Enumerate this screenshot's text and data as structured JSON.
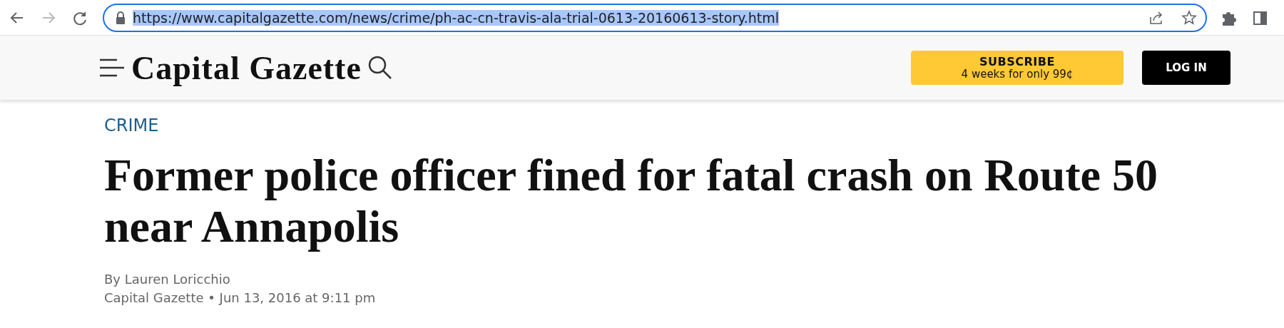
{
  "browser": {
    "url": "https://www.capitalgazette.com/news/crime/ph-ac-cn-travis-ala-trial-0613-20160613-story.html",
    "url_selected": true
  },
  "header": {
    "logo": "Capital Gazette",
    "subscribe": {
      "title": "SUBSCRIBE",
      "offer": "4 weeks for only 99¢"
    },
    "login": "LOG IN"
  },
  "article": {
    "section": "CRIME",
    "headline": "Former police officer fined for fatal crash on Route 50 near Annapolis",
    "byline": "By Lauren Loricchio",
    "dateline": "Capital Gazette • Jun 13, 2016 at 9:11 pm"
  }
}
